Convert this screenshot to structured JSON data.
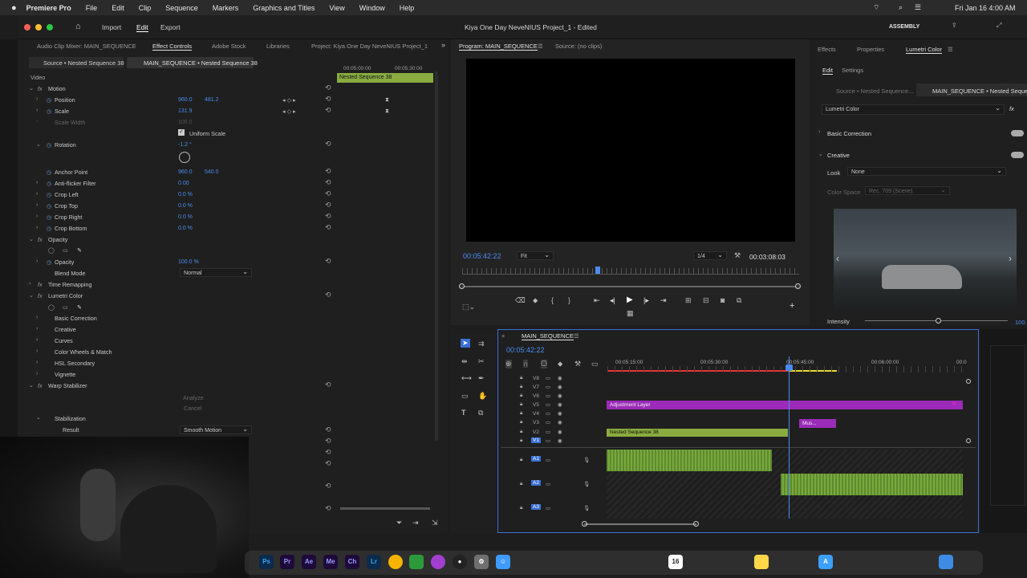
{
  "menubar": {
    "app": "Premiere Pro",
    "items": [
      "File",
      "Edit",
      "Clip",
      "Sequence",
      "Markers",
      "Graphics and Titles",
      "View",
      "Window",
      "Help"
    ],
    "clock": "Fri Jan 16  4:00 AM"
  },
  "titlebar": {
    "home_icon": "home-icon",
    "tabs": [
      "Import",
      "Edit",
      "Export"
    ],
    "title": "Kiya One Day NeveNIUS Project_1 - Edited",
    "workspace": "ASSEMBLY"
  },
  "left_panel": {
    "tabs": [
      "Audio Clip Mixer: MAIN_SEQUENCE",
      "Effect Controls",
      "Adobe Stock",
      "Libraries",
      "Project: Kiya One Day NeveNIUS Project_1"
    ],
    "source": "Source • Nested Sequence 38",
    "target": "MAIN_SEQUENCE • Nested Sequence 38",
    "mini_tc1": "00:05:00:00",
    "mini_tc2": "00:05:30:00",
    "mini_clip": "Nested Sequence 38",
    "video": "Video",
    "motion": "Motion",
    "position": {
      "label": "Position",
      "x": "960.0",
      "y": "481.2"
    },
    "scale": {
      "label": "Scale",
      "v": "131.9"
    },
    "scale_width": {
      "label": "Scale Width",
      "v": "100.0"
    },
    "uniform": "Uniform Scale",
    "rotation": {
      "label": "Rotation",
      "v": "-1.2 °"
    },
    "anchor": {
      "label": "Anchor Point",
      "x": "960.0",
      "y": "540.0"
    },
    "flicker": {
      "label": "Anti-flicker Filter",
      "v": "0.00"
    },
    "crops": [
      {
        "label": "Crop Left",
        "v": "0.0 %"
      },
      {
        "label": "Crop Top",
        "v": "0.0 %"
      },
      {
        "label": "Crop Right",
        "v": "0.0 %"
      },
      {
        "label": "Crop Bottom",
        "v": "0.0 %"
      }
    ],
    "opacity": "Opacity",
    "opacity_val": {
      "label": "Opacity",
      "v": "100.0 %"
    },
    "blend": {
      "label": "Blend Mode",
      "v": "Normal"
    },
    "time_remap": "Time Remapping",
    "lumetri": "Lumetri Color",
    "lumetri_items": [
      "Basic Correction",
      "Creative",
      "Curves",
      "Color Wheels & Match",
      "HSL Secondary",
      "Vignette"
    ],
    "warp": "Warp Stabilizer",
    "analyze": "Analyze",
    "cancel": "Cancel",
    "stabilization": "Stabilization",
    "result": {
      "label": "Result",
      "v": "Smooth Motion"
    }
  },
  "program": {
    "tab": "Program: MAIN_SEQUENCE",
    "source_tab": "Source: (no clips)",
    "timecode": "00:05:42:22",
    "fit": "Fit",
    "quality": "1/4",
    "duration": "00:03:08:03"
  },
  "right_panel": {
    "tabs": [
      "Effects",
      "Properties",
      "Lumetri Color"
    ],
    "sub": [
      "Edit",
      "Settings"
    ],
    "source": "Source • Nested Sequence...",
    "target": "MAIN_SEQUENCE • Nested Seque",
    "effect": "Lumetri Color",
    "basic": "Basic Correction",
    "creative": "Creative",
    "look_label": "Look",
    "look_value": "None",
    "colorspace_label": "Color Space",
    "colorspace_value": "Rec. 709 (Scene)",
    "intensity_label": "Intensity",
    "intensity_value": "100.0"
  },
  "timeline": {
    "title": "MAIN_SEQUENCE",
    "timecode": "00:05:42:22",
    "ruler": [
      "00:05:15:00",
      "00:05:30:00",
      "00:05:45:00",
      "00:06:00:00",
      "00:0"
    ],
    "video_tracks": [
      "V8",
      "V7",
      "V6",
      "V5",
      "V4",
      "V3",
      "V2",
      "V1"
    ],
    "audio_tracks": [
      "A1",
      "A2",
      "A3"
    ],
    "clip_adjust": "Adjustment Layer",
    "clip_music": "Mus...",
    "clip_nested": "Nested Sequence 38"
  },
  "colors": {
    "accent": "#4a8cf0",
    "purple": "#9b2bb8",
    "green": "#6f9e3a",
    "timeline_head": "#e33"
  },
  "dock": [
    "Ps",
    "Pr",
    "Ae",
    "Me",
    "Ch",
    "Lr",
    "16"
  ]
}
